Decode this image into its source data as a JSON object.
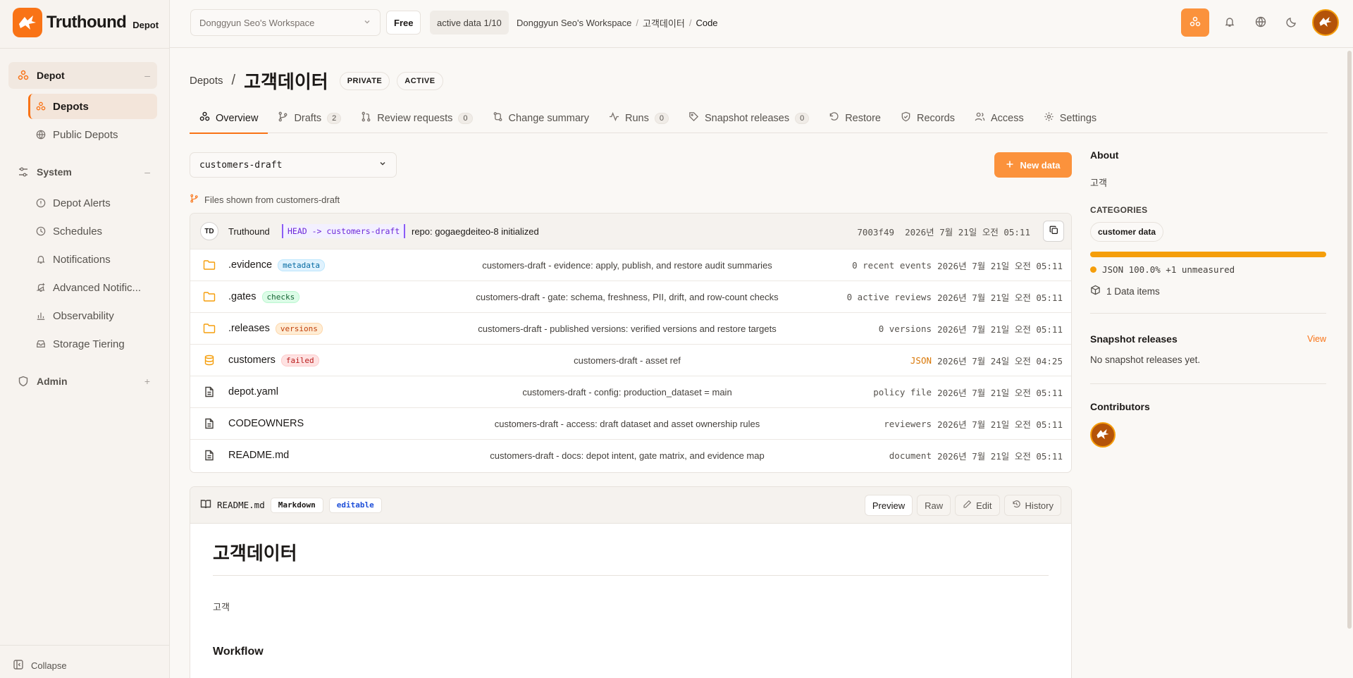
{
  "brand": {
    "name": "Truthound",
    "sub": "Depot"
  },
  "sidebar": {
    "groups": [
      {
        "label": "Depot",
        "toggle": "–"
      },
      {
        "label": "System",
        "toggle": "–"
      },
      {
        "label": "Admin",
        "toggle": "+"
      }
    ],
    "depot_items": [
      {
        "label": "Depots"
      },
      {
        "label": "Public Depots"
      }
    ],
    "system_items": [
      {
        "label": "Depot Alerts"
      },
      {
        "label": "Schedules"
      },
      {
        "label": "Notifications"
      },
      {
        "label": "Advanced Notific..."
      },
      {
        "label": "Observability"
      },
      {
        "label": "Storage Tiering"
      }
    ],
    "collapse_label": "Collapse"
  },
  "topbar": {
    "workspace_select": "Donggyun Seo's Workspace",
    "plan": "Free",
    "active_data": "active data 1/10",
    "breadcrumb": [
      "Donggyun Seo's Workspace",
      "고객데이터",
      "Code"
    ]
  },
  "header": {
    "crumb": "Depots",
    "title": "고객데이터",
    "tags": [
      "PRIVATE",
      "ACTIVE"
    ]
  },
  "tabs": [
    {
      "label": "Overview",
      "count": ""
    },
    {
      "label": "Drafts",
      "count": "2"
    },
    {
      "label": "Review requests",
      "count": "0"
    },
    {
      "label": "Change summary",
      "count": ""
    },
    {
      "label": "Runs",
      "count": "0"
    },
    {
      "label": "Snapshot releases",
      "count": "0"
    },
    {
      "label": "Restore",
      "count": ""
    },
    {
      "label": "Records",
      "count": ""
    },
    {
      "label": "Access",
      "count": ""
    },
    {
      "label": "Settings",
      "count": ""
    }
  ],
  "branch": {
    "selected": "customers-draft"
  },
  "new_data_label": "New data",
  "files_from": "Files shown from customers-draft",
  "commit": {
    "avatar": "TD",
    "user": "Truthound",
    "ref": "HEAD -> customers-draft",
    "message": "repo: gogaegdeiteo-8 initialized",
    "sha": "7003f49",
    "date": "2026년 7월 21일 오전 05:11"
  },
  "files": [
    {
      "name": ".evidence",
      "badge": "metadata",
      "message": "customers-draft - evidence: apply, publish, and restore audit summaries",
      "meta": "0 recent events",
      "date": "2026년 7월 21일 오전 05:11"
    },
    {
      "name": ".gates",
      "badge": "checks",
      "message": "customers-draft - gate: schema, freshness, PII, drift, and row-count checks",
      "meta": "0 active reviews",
      "date": "2026년 7월 21일 오전 05:11"
    },
    {
      "name": ".releases",
      "badge": "versions",
      "message": "customers-draft - published versions: verified versions and restore targets",
      "meta": "0 versions",
      "date": "2026년 7월 21일 오전 05:11"
    },
    {
      "name": "customers",
      "badge": "failed",
      "message": "customers-draft - asset ref",
      "meta": "JSON",
      "date": "2026년 7월 24일 오전 04:25"
    },
    {
      "name": "depot.yaml",
      "badge": "",
      "message": "customers-draft - config: production_dataset = main",
      "meta": "policy file",
      "date": "2026년 7월 21일 오전 05:11"
    },
    {
      "name": "CODEOWNERS",
      "badge": "",
      "message": "customers-draft - access: draft dataset and asset ownership rules",
      "meta": "reviewers",
      "date": "2026년 7월 21일 오전 05:11"
    },
    {
      "name": "README.md",
      "badge": "",
      "message": "customers-draft - docs: depot intent, gate matrix, and evidence map",
      "meta": "document",
      "date": "2026년 7월 21일 오전 05:11"
    }
  ],
  "readme": {
    "filename": "README.md",
    "chips": [
      "Markdown",
      "editable"
    ],
    "actions": [
      "Preview",
      "Raw",
      "Edit",
      "History"
    ],
    "h1": "고객데이터",
    "paragraph": "고객",
    "h2": "Workflow"
  },
  "about": {
    "title": "About",
    "description": "고객",
    "categories_label": "CATEGORIES",
    "category": "customer data",
    "language_legend": "JSON 100.0% +1 unmeasured",
    "language_fraction": 1.0,
    "data_items": "1 Data items",
    "snapshot_title": "Snapshot releases",
    "snapshot_view": "View",
    "snapshot_empty": "No snapshot releases yet.",
    "contributors_title": "Contributors"
  },
  "colors": {
    "accent": "#f97316",
    "accent_soft": "#fb923c",
    "json": "#f59e0b"
  }
}
